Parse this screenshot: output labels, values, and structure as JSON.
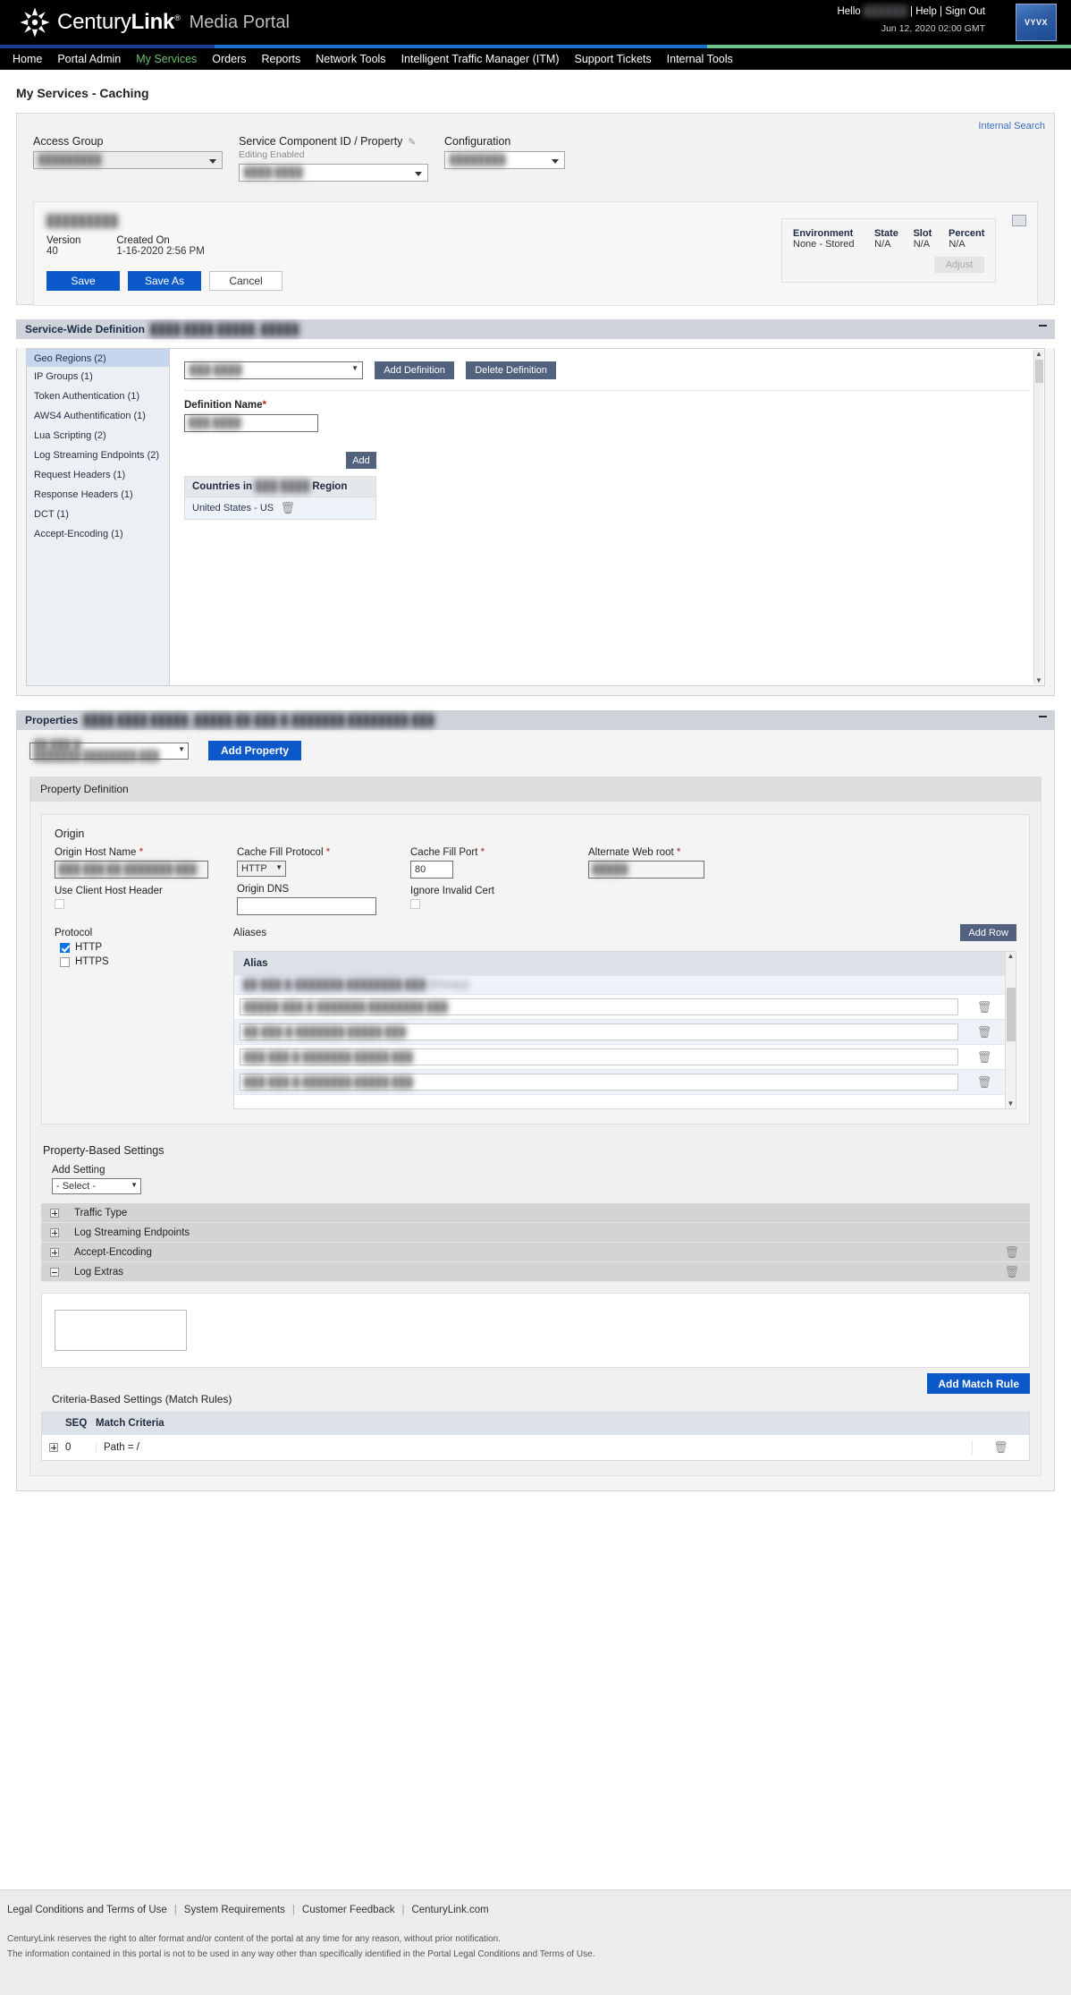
{
  "header": {
    "brand_century": "Century",
    "brand_link": "Link",
    "brand_reg": "®",
    "brand_portal": "Media Portal",
    "hello": "Hello",
    "user_name_redacted": "██████",
    "sep": "|",
    "help": "Help",
    "sign_out": "Sign Out",
    "date": "Jun 12, 2020 02:00 GMT",
    "vyvx_logo": "VYVX"
  },
  "stripe_colors": [
    "#1b3f94",
    "#1f6fd0",
    "#6dc38b"
  ],
  "nav": {
    "items": [
      {
        "label": "Home",
        "active": false
      },
      {
        "label": "Portal Admin",
        "active": false
      },
      {
        "label": "My Services",
        "active": true
      },
      {
        "label": "Orders",
        "active": false
      },
      {
        "label": "Reports",
        "active": false
      },
      {
        "label": "Network Tools",
        "active": false
      },
      {
        "label": "Intelligent Traffic Manager (ITM)",
        "active": false
      },
      {
        "label": "Support Tickets",
        "active": false
      },
      {
        "label": "Internal Tools",
        "active": false
      }
    ]
  },
  "page": {
    "title": "My Services - Caching",
    "internal_search": "Internal Search"
  },
  "selectors": {
    "access_group": {
      "label": "Access Group",
      "value_redacted": "█████████"
    },
    "service_component": {
      "label": "Service Component ID / Property",
      "editing": "Editing Enabled",
      "value_redacted": "████ ████"
    },
    "configuration": {
      "label": "Configuration",
      "value_redacted": "████████"
    }
  },
  "version_card": {
    "config_name_redacted": "█████████",
    "version_label": "Version",
    "version_value": "40",
    "created_on_label": "Created On",
    "created_on_value": "1-16-2020 2:56 PM",
    "save": "Save",
    "save_as": "Save As",
    "cancel": "Cancel",
    "env": {
      "head": [
        "Environment",
        "State",
        "Slot",
        "Percent"
      ],
      "values": [
        "None - Stored",
        "N/A",
        "N/A",
        "N/A"
      ],
      "adjust": "Adjust"
    }
  },
  "service_wide": {
    "header": "Service-Wide Definition",
    "header_sub_redacted": "████ ████  █████_█████",
    "categories": [
      {
        "label": "Geo Regions (2)",
        "selected": true
      },
      {
        "label": "IP Groups (1)",
        "selected": false
      },
      {
        "label": "Token Authentication (1)",
        "selected": false
      },
      {
        "label": "AWS4 Authentification (1)",
        "selected": false
      },
      {
        "label": "Lua Scripting (2)",
        "selected": false
      },
      {
        "label": "Log Streaming Endpoints (2)",
        "selected": false
      },
      {
        "label": "Request Headers (1)",
        "selected": false
      },
      {
        "label": "Response Headers (1)",
        "selected": false
      },
      {
        "label": "DCT (1)",
        "selected": false
      },
      {
        "label": "Accept-Encoding (1)",
        "selected": false
      }
    ],
    "definition_select_redacted": "███-████",
    "add_definition": "Add Definition",
    "delete_definition": "Delete Definition",
    "definition_name_label": "Definition Name",
    "definition_name_required": "*",
    "definition_name_value_redacted": "███-████",
    "add": "Add",
    "countries_prefix": "Countries in",
    "countries_region_redacted": "███-████",
    "countries_suffix": "Region",
    "countries": [
      "United States - US"
    ]
  },
  "properties": {
    "header": "Properties",
    "header_sub_redacted": "████ ████  █████_█████  ██-███-█-███████.████████.███",
    "property_select_redacted": "██-███-█-███████.████████.███",
    "add_property": "Add Property"
  },
  "property_definition": {
    "header": "Property Definition",
    "origin": {
      "title": "Origin",
      "host_name_label": "Origin Host Name",
      "host_name_required": "*",
      "host_name_value_redacted": "███-███.██-███████.███",
      "cache_fill_protocol_label": "Cache Fill Protocol",
      "cache_fill_protocol_required": "*",
      "cache_fill_protocol_value": "HTTP",
      "cache_fill_port_label": "Cache Fill Port",
      "cache_fill_port_required": "*",
      "cache_fill_port_value": "80",
      "alternate_web_root_label": "Alternate Web root",
      "alternate_web_root_required": "*",
      "alternate_web_root_value_redacted": "█████",
      "use_client_host_header_label": "Use Client Host Header",
      "use_client_host_header_checked": false,
      "origin_dns_label": "Origin DNS",
      "origin_dns_value": "",
      "ignore_invalid_cert_label": "Ignore Invalid Cert",
      "ignore_invalid_cert_checked": false
    },
    "protocol": {
      "title": "Protocol",
      "options": [
        {
          "label": "HTTP",
          "checked": true
        },
        {
          "label": "HTTPS",
          "checked": false
        }
      ]
    },
    "aliases": {
      "title": "Aliases",
      "add_row": "Add Row",
      "column_header": "Alias",
      "rows": [
        {
          "value_redacted": "██-███-█-███████.████████.███ (Primary)",
          "editable": false,
          "deletable": false
        },
        {
          "value_redacted": "█████-███-█-███████.████████.███",
          "editable": true,
          "deletable": true
        },
        {
          "value_redacted": "██-███-█-███████.█████.███",
          "editable": true,
          "deletable": true
        },
        {
          "value_redacted": "███-███-█-███████.█████.███",
          "editable": true,
          "deletable": true
        },
        {
          "value_redacted": "███-███-█-███████.█████.███",
          "editable": true,
          "deletable": true
        }
      ]
    },
    "property_based_settings": {
      "title": "Property-Based Settings",
      "add_setting_label": "Add Setting",
      "add_setting_value": "- Select -",
      "rows": [
        {
          "label": "Traffic Type",
          "expanded": false,
          "deletable": false
        },
        {
          "label": "Log Streaming Endpoints",
          "expanded": false,
          "deletable": false
        },
        {
          "label": "Accept-Encoding",
          "expanded": false,
          "deletable": true
        },
        {
          "label": "Log Extras",
          "expanded": true,
          "deletable": true
        }
      ],
      "log_extras_value": ""
    },
    "criteria_based_settings": {
      "title": "Criteria-Based Settings (Match Rules)",
      "add_match_rule": "Add Match Rule",
      "columns": [
        "SEQ",
        "Match Criteria"
      ],
      "rows": [
        {
          "seq": "0",
          "criteria": "Path = /"
        }
      ]
    }
  },
  "footer": {
    "links": [
      "Legal Conditions and Terms of Use",
      "System Requirements",
      "Customer Feedback",
      "CenturyLink.com"
    ],
    "separator": "|",
    "fine_line1": "CenturyLink reserves the right to alter format and/or content of the portal at any time for any reason, without prior notification.",
    "fine_line2": "The information contained in this portal is not to be used in any way other than specifically identified in the Portal Legal Conditions and Terms of Use."
  }
}
